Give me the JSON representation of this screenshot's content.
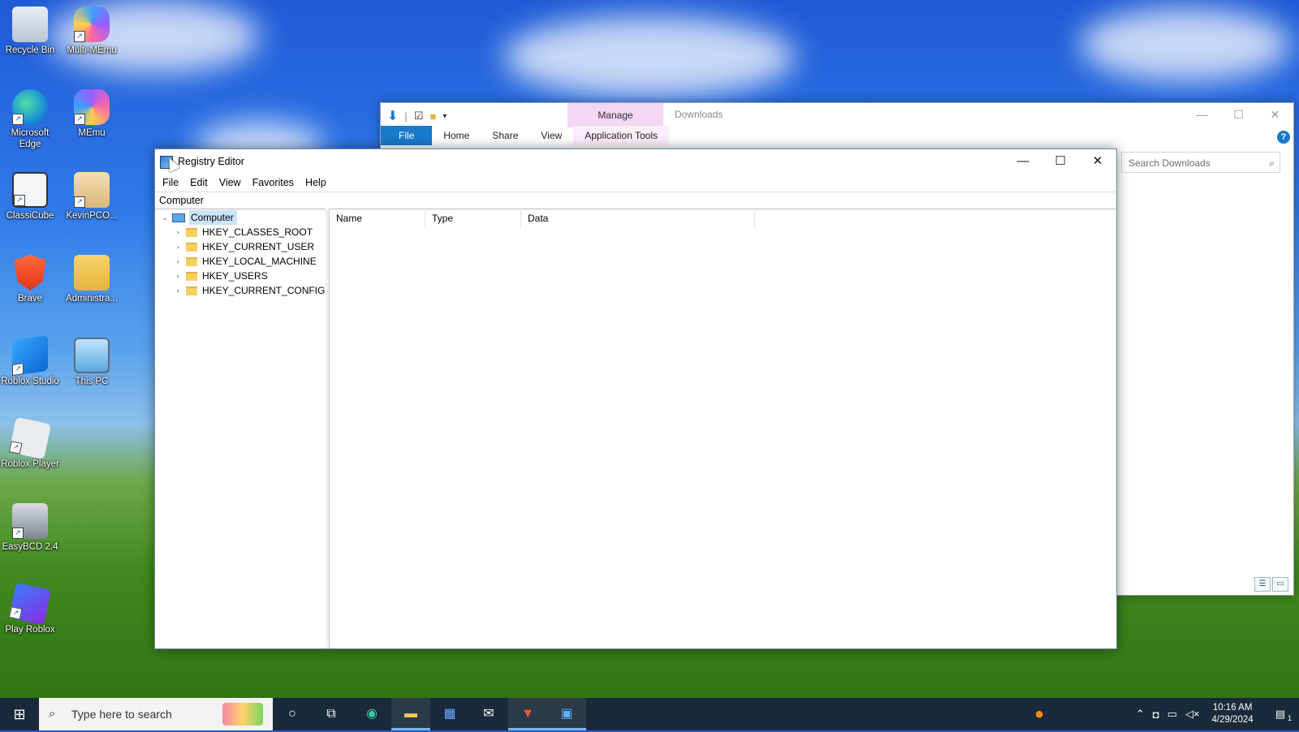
{
  "desktop": {
    "icons": [
      {
        "label": "Recycle Bin"
      },
      {
        "label": "Multi-MEmu"
      },
      {
        "label": "Microsoft Edge"
      },
      {
        "label": "MEmu"
      },
      {
        "label": "ClassiCube"
      },
      {
        "label": "KevinPCO..."
      },
      {
        "label": "Brave"
      },
      {
        "label": "Administra..."
      },
      {
        "label": "Roblox Studio"
      },
      {
        "label": "This PC"
      },
      {
        "label": "Roblox Player"
      },
      {
        "label": "EasyBCD 2.4"
      },
      {
        "label": "Play Roblox"
      }
    ]
  },
  "explorer": {
    "manage_tab": "Manage",
    "title": "Downloads",
    "tabs": [
      "File",
      "Home",
      "Share",
      "View",
      "Application Tools"
    ],
    "search_placeholder": "Search Downloads",
    "help": "?"
  },
  "regedit": {
    "title": "Registry Editor",
    "menu": [
      "File",
      "Edit",
      "View",
      "Favorites",
      "Help"
    ],
    "address": "Computer",
    "tree": {
      "root": "Computer",
      "keys": [
        "HKEY_CLASSES_ROOT",
        "HKEY_CURRENT_USER",
        "HKEY_LOCAL_MACHINE",
        "HKEY_USERS",
        "HKEY_CURRENT_CONFIG"
      ]
    },
    "columns": [
      "Name",
      "Type",
      "Data"
    ]
  },
  "taskbar": {
    "search_placeholder": "Type here to search",
    "time": "10:16 AM",
    "date": "4/29/2024",
    "notification_count": "1"
  }
}
